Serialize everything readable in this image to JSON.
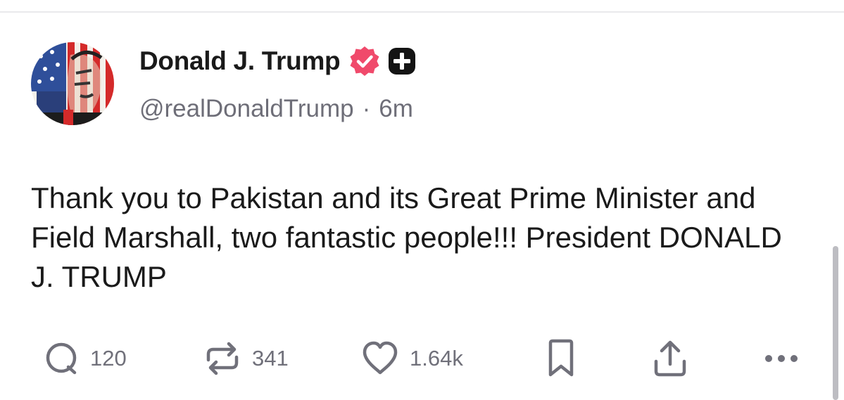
{
  "post": {
    "author": {
      "display_name": "Donald J. Trump",
      "handle": "@realDonaldTrump",
      "badges": [
        "verified-badge-icon",
        "plus-badge-icon"
      ]
    },
    "separator": "·",
    "time_ago": "6m",
    "text": "Thank you to Pakistan and its Great Prime Minister and Field Marshall, two fantastic people!!! President DONALD J. TRUMP"
  },
  "actions": {
    "replies": {
      "icon": "comment-icon",
      "count": "120"
    },
    "reposts": {
      "icon": "repost-icon",
      "count": "341"
    },
    "likes": {
      "icon": "heart-icon",
      "count": "1.64k"
    },
    "bookmark": {
      "icon": "bookmark-icon"
    },
    "share": {
      "icon": "share-icon"
    },
    "more": {
      "icon": "more-icon"
    }
  },
  "colors": {
    "verified": "#f04a6b",
    "text": "#1a1a1a",
    "muted": "#6e6e78",
    "divider": "#e9e9ec"
  }
}
